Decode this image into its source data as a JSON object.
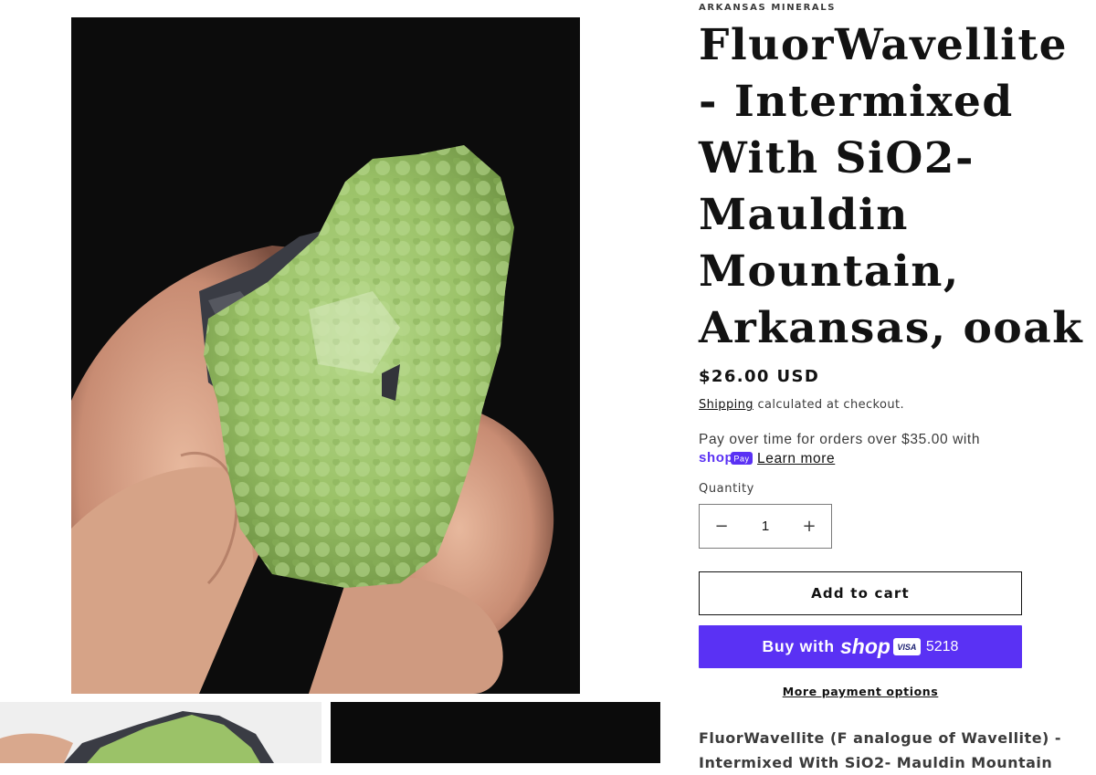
{
  "product": {
    "vendor": "ARKANSAS MINERALS",
    "title": "FluorWavellite - Intermixed With SiO2- Mauldin Mountain, Arkansas, ooak",
    "price": "$26.00 USD",
    "shipping_link": "Shipping",
    "shipping_rest": " calculated at checkout.",
    "installments": {
      "text": "Pay over time for orders over $35.00 with",
      "learn_more": "Learn more",
      "logo_text": "shop",
      "logo_badge": "Pay"
    },
    "quantity": {
      "label": "Quantity",
      "value": "1",
      "minus": "−",
      "plus": "+"
    },
    "add_to_cart": "Add to cart",
    "buy_with": {
      "label": "Buy with",
      "brand": "shop",
      "card_brand": "VISA",
      "last4": "5218"
    },
    "more_payment_options": "More payment options",
    "description": "FluorWavellite (F analogue of Wavellite) - Intermixed With SiO2- Mauldin Mountain"
  },
  "gallery": {
    "main_image": "mineral-specimen-photo",
    "thumbnails": [
      "thumbnail-1",
      "thumbnail-2"
    ]
  },
  "colors": {
    "shop_purple": "#5a31f4",
    "text": "#121212",
    "mineral_green": "#9bc268"
  }
}
